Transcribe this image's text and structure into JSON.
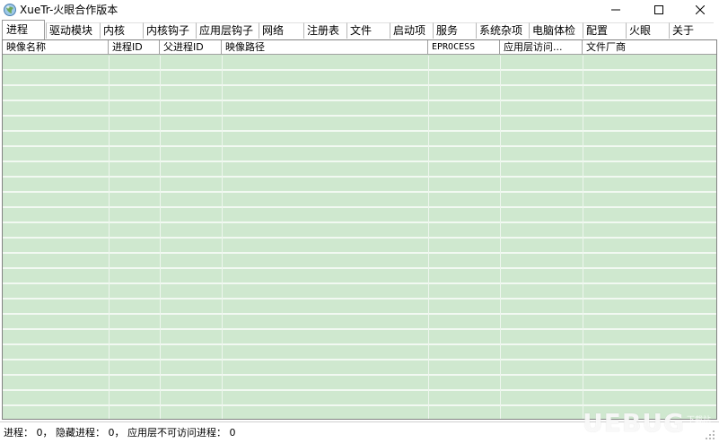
{
  "window": {
    "title": "XueTr-火眼合作版本",
    "icon": "app-globe-icon",
    "controls": {
      "minimize": "minimize-icon",
      "maximize": "maximize-icon",
      "close": "close-icon"
    }
  },
  "tabs": [
    {
      "label": "进程",
      "active": true
    },
    {
      "label": "驱动模块"
    },
    {
      "label": "内核"
    },
    {
      "label": "内核钩子"
    },
    {
      "label": "应用层钩子"
    },
    {
      "label": "网络"
    },
    {
      "label": "注册表"
    },
    {
      "label": "文件"
    },
    {
      "label": "启动项"
    },
    {
      "label": "服务"
    },
    {
      "label": "系统杂项"
    },
    {
      "label": "电脑体检"
    },
    {
      "label": "配置"
    },
    {
      "label": "火眼"
    },
    {
      "label": "关于"
    }
  ],
  "process_list": {
    "columns": [
      {
        "label": "映像名称"
      },
      {
        "label": "进程ID"
      },
      {
        "label": "父进程ID"
      },
      {
        "label": "映像路径"
      },
      {
        "label": "EPROCESS"
      },
      {
        "label": "应用层访问..."
      },
      {
        "label": "文件厂商"
      }
    ],
    "rows": []
  },
  "status": {
    "text": "进程： 0， 隐藏进程： 0， 应用层不可访问进程： 0"
  },
  "watermark": {
    "text": "UEBUG",
    "sub": "下载站"
  },
  "colors": {
    "row_fill": "#cfe8cf",
    "row_separator": "#f2f9f2"
  }
}
